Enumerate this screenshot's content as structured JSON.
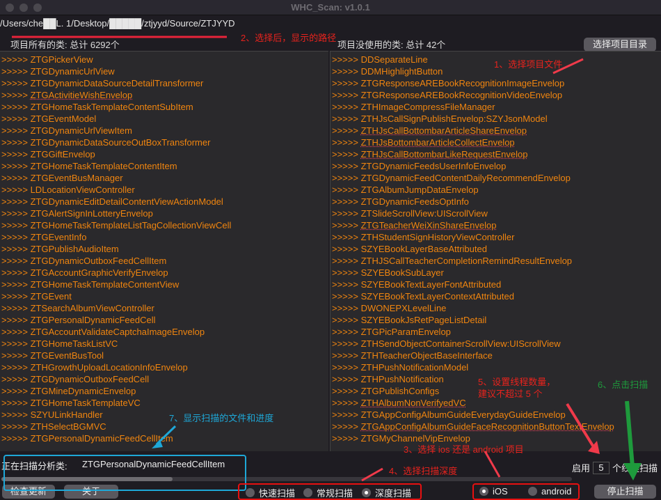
{
  "window": {
    "title": "WHC_Scan: v1.0.1"
  },
  "path": "/Users/che██L.  1/Desktop/█████/ztjyyd/Source/ZTJYYD",
  "left": {
    "header": "项目所有的类: 总计 6292个",
    "items": [
      "ZTGPickerView",
      "ZTGDynamicUrlView",
      "ZTGDynamicDataSourceDetailTransformer",
      "ZTGActivitieWishEnvelop",
      "ZTGHomeTaskTemplateContentSubItem",
      "ZTGEventModel",
      "ZTGDynamicUrlViewItem",
      "ZTGDynamicDataSourceOutBoxTransformer",
      "ZTGGiftEnvelop",
      "ZTGHomeTaskTemplateContentItem",
      "ZTGEventBusManager",
      "LDLocationViewController",
      "ZTGDynamicEditDetailContentViewActionModel",
      "ZTGAlertSignInLotteryEnvelop",
      "ZTGHomeTaskTemplateListTagCollectionViewCell",
      "ZTGEventInfo",
      "ZTGPublishAudioItem",
      "ZTGDynamicOutboxFeedCellItem",
      "ZTGAccountGraphicVerifyEnvelop",
      "ZTGHomeTaskTemplateContentView",
      "ZTGEvent",
      "ZTSearchAlbumViewController",
      "ZTGPersonalDynamicFeedCell",
      "ZTGAccountValidateCaptchaImageEnvelop",
      "ZTGHomeTaskListVC",
      "ZTGEventBusTool",
      "ZTHGrowthUploadLocationInfoEnvelop",
      "ZTGDynamicOutboxFeedCell",
      "ZTGMineDynamicEnvelop",
      "ZTGHomeTaskTemplateVC",
      "SZYULinkHandler",
      "ZTHSelectBGMVC",
      "ZTGPersonalDynamicFeedCellItem"
    ]
  },
  "right": {
    "header": "项目没使用的类: 总计 42个",
    "items": [
      "DDSeparateLine",
      "DDMHighlightButton",
      "ZTGResponseAREBookRecognitionImageEnvelop",
      "ZTGResponseAREBookRecognitionVideoEnvelop",
      "ZTHImageCompressFileManager",
      "ZTHJsCallSignPublishEnvelop:SZYJsonModel",
      "ZTHJsCallBottombarArticleShareEnvelop",
      "ZTHJsBottombarArticleCollectEnvelop",
      "ZTHJsCallBottombarLikeRequestEnvelop",
      "ZTGDynamicFeedsUserInfoEnvelop",
      "ZTGDynamicFeedContentDailyRecommendEnvelop",
      "ZTGAlbumJumpDataEnvelop",
      "ZTGDynamicFeedsOptInfo",
      "ZTSlideScrollView:UIScrollView",
      "ZTGTeacherWeiXinShareEnvelop",
      "ZTHStudentSignHistoryViewController",
      "SZYEBookLayerBaseAttributed",
      "ZTHJSCallTeacherCompletionRemindResultEnvelop",
      "SZYEBookSubLayer",
      "SZYEBookTextLayerFontAttributed",
      "SZYEBookTextLayerContextAttributed",
      "DWONEPXLevelLine",
      "SZYEBookJsRetPageListDetail",
      "ZTGPicParamEnvelop",
      "ZTHSendObjectContainerScrollView:UIScrollView",
      "ZTHTeacherObjectBaseInterface",
      "ZTHPushNotificationModel",
      "ZTHPushNotification",
      "ZTGPublishConfigs",
      "ZTHAlbumNonVerifyedVC",
      "ZTGAppConfigAlbumGuideEverydayGuideEnvelop",
      "ZTGAppConfigAlbumGuideFaceRecognitionButtonTextEnvelop",
      "ZTGMyChannelVipEnvelop"
    ]
  },
  "prefix": ">>>>> ",
  "select_dir_button": "选择项目目录",
  "scan": {
    "label": "正在扫描分析类:",
    "current": "ZTGPersonalDynamicFeedCellItem",
    "progress": 0.3
  },
  "buttons": {
    "check_update": "检查更新",
    "about": "关于",
    "stop_scan": "停止扫描"
  },
  "depth": {
    "options": [
      "快速扫描",
      "常规扫描",
      "深度扫描"
    ],
    "selected": "深度扫描"
  },
  "platform": {
    "options": [
      "iOS",
      "android"
    ],
    "selected": "iOS"
  },
  "threads": {
    "prefix": "启用",
    "value": "5",
    "suffix": "个线程扫描"
  },
  "annotations": {
    "n1": "1、选择项目文件",
    "n2": "2、选择后，显示的路径",
    "n3": "3、选择 ios 还是 android 项目",
    "n4": "4、选择扫描深度",
    "n5a": "5、设置线程数量，",
    "n5b": "建议不超过 5 个",
    "n6": "6、点击扫描",
    "n7": "7、显示扫描的文件和进度"
  },
  "colors": {
    "item": "#f0850f",
    "note": "#e8231d",
    "note6": "#1e9a3c",
    "note7": "#1ea8d8"
  }
}
